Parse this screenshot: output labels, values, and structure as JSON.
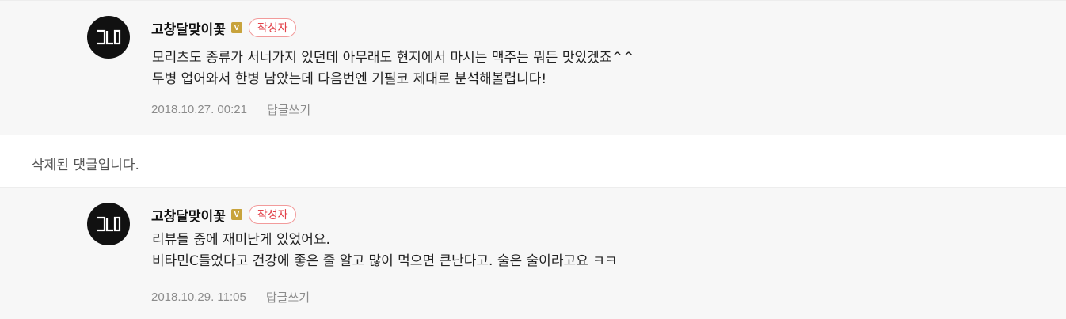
{
  "comments": [
    {
      "nickname": "고창달맞이꽃",
      "verified_mark": "V",
      "author_badge": "작성자",
      "text": "모리츠도 종류가 서너가지 있던데 아무래도 현지에서 마시는 맥주는 뭐든 맛있겠죠^^\n두병 업어와서 한병 남았는데 다음번엔 기필코 제대로 분석해볼렵니다!",
      "date": "2018.10.27. 00:21",
      "reply_label": "답글쓰기"
    },
    {
      "nickname": "고창달맞이꽃",
      "verified_mark": "V",
      "author_badge": "작성자",
      "text": "리뷰들 중에 재미난게 있었어요.\n비타민C들었다고 건강에 좋은 줄 알고 많이 먹으면 큰난다고. 술은 술이라고요 ㅋㅋ",
      "date": "2018.10.29. 11:05",
      "reply_label": "답글쓰기"
    }
  ],
  "deleted_notice": "삭제된 댓글입니다.",
  "colors": {
    "reply_bg": "#f7f7f7",
    "verified": "#c8a33c",
    "author_badge": "#e2424a"
  },
  "icons": {
    "avatar": "profile-logo-icon"
  }
}
